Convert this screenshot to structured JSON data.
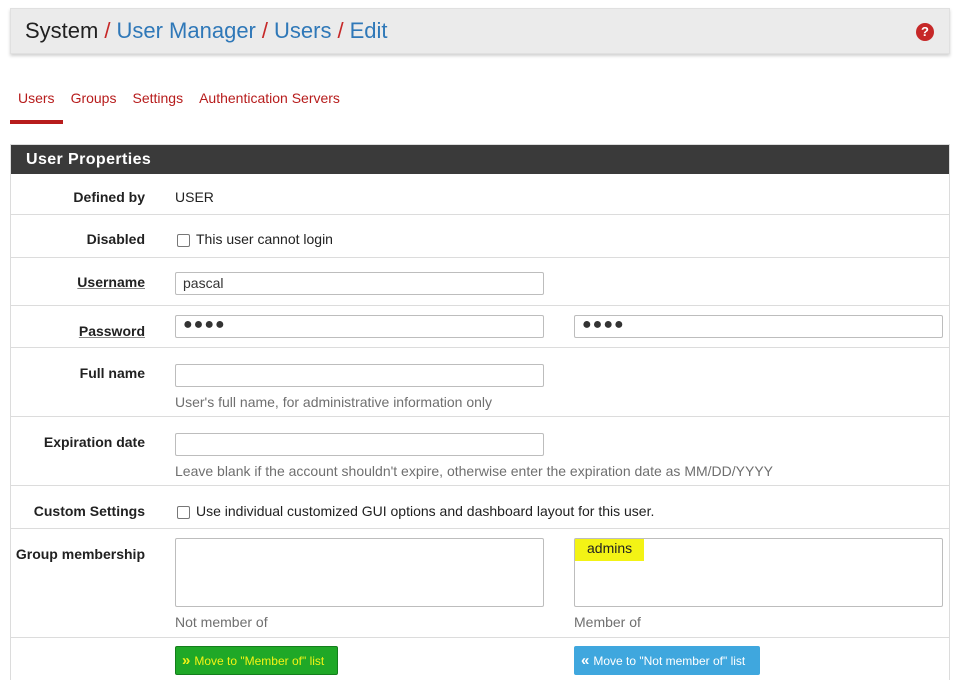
{
  "breadcrumb": {
    "root": "System",
    "sep": "/",
    "items": [
      "User Manager",
      "Users",
      "Edit"
    ]
  },
  "help_icon": {
    "glyph": "?"
  },
  "tabs": [
    "Users",
    "Groups",
    "Settings",
    "Authentication Servers"
  ],
  "panel": {
    "title": "User Properties"
  },
  "fields": {
    "defined_by": {
      "label": "Defined by",
      "value": "USER"
    },
    "disabled": {
      "label": "Disabled",
      "checkbox_text": "This user cannot login"
    },
    "username": {
      "label": "Username",
      "value": "pascal"
    },
    "password": {
      "label": "Password",
      "value": "●●●●",
      "confirm_value": "●●●●"
    },
    "full_name": {
      "label": "Full name",
      "value": "",
      "help": "User's full name, for administrative information only"
    },
    "expiration": {
      "label": "Expiration date",
      "value": "",
      "help": "Leave blank if the account shouldn't expire, otherwise enter the expiration date as MM/DD/YYYY"
    },
    "custom_settings": {
      "label": "Custom Settings",
      "checkbox_text": "Use individual customized GUI options and dashboard layout for this user."
    },
    "group_membership": {
      "label": "Group membership",
      "not_member_items": [],
      "member_items": [
        "admins"
      ],
      "not_member_caption": "Not member of",
      "member_caption": "Member of"
    }
  },
  "buttons": {
    "move_to_member": {
      "icon": "double-chevron-right-icon",
      "label": "Move to \"Member of\" list"
    },
    "move_to_not_member": {
      "icon": "double-chevron-left-icon",
      "label": "Move to \"Not member of\" list"
    }
  },
  "colors": {
    "accent": "#b71c1c",
    "link": "#2f78b8",
    "panel_heading": "#3a3a3a",
    "highlight": "#f3f315",
    "success": "#1fa827",
    "info": "#3fa7de"
  }
}
